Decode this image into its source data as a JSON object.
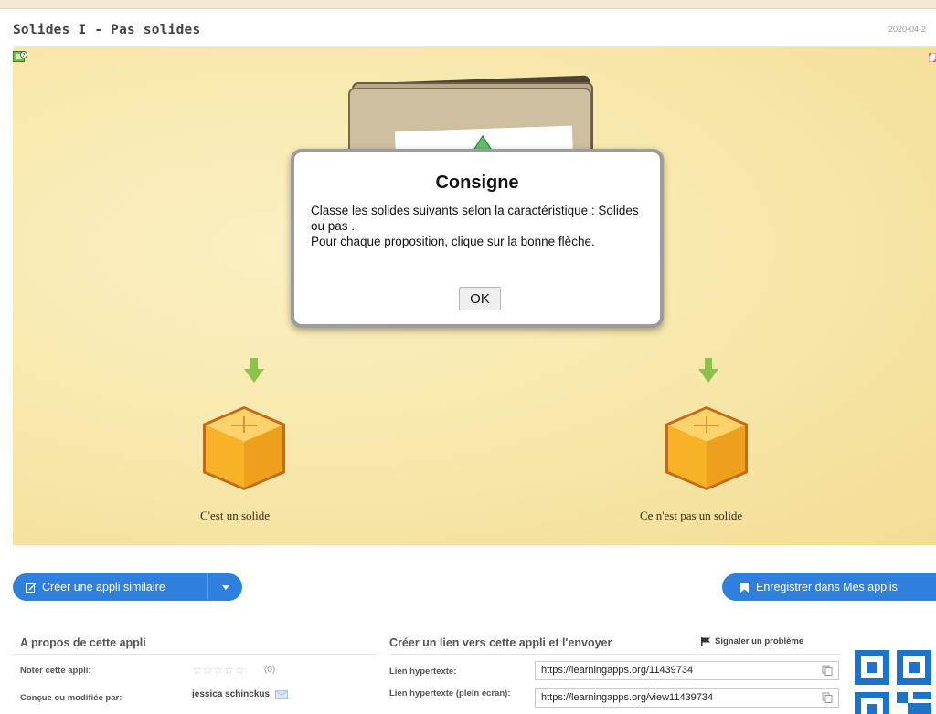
{
  "app": {
    "title": "Solides I - Pas solides",
    "date": "2020-04-2"
  },
  "stage": {
    "left_category": "C'est un solide",
    "right_category": "Ce n'est pas un solide"
  },
  "modal": {
    "title": "Consigne",
    "text": "Classe les solides suivants selon la caractéristique : Solides ou pas .\nPour chaque proposition, clique sur la bonne flèche.",
    "ok_label": "OK"
  },
  "actions": {
    "create_similar": "Créer une appli similaire",
    "save": "Enregistrer dans Mes applis"
  },
  "about": {
    "title": "A propos de cette appli",
    "rate_label": "Noter cette appli:",
    "votes": "(0)",
    "rating": 0,
    "rating_max": 5,
    "author_label": "Conçue ou modifiée par:",
    "author": "jessica schinckus"
  },
  "share": {
    "title": "Créer un lien vers cette appli et l'envoyer",
    "report": "Signaler un problème",
    "link_label": "Lien hypertexte:",
    "link_value": "https://learningapps.org/11439734",
    "fullscreen_label": "Lien hypertexte (plein écran):",
    "fullscreen_value": "https://learningapps.org/view11439734"
  },
  "colors": {
    "accent": "#2f7fdc",
    "stage_bg": "#f8e8ac",
    "arrow": "#8bc34a",
    "box": "#f5b731",
    "triangle": "#5cc267",
    "qr": "#1d73c9"
  },
  "icons": {
    "help": "help-icon",
    "fullscreen": "fullscreen-icon",
    "edit": "edit-icon",
    "caret": "caret-down-icon",
    "bookmark": "bookmark-icon",
    "flag": "flag-icon",
    "mail": "mail-icon",
    "copy": "copy-icon"
  }
}
